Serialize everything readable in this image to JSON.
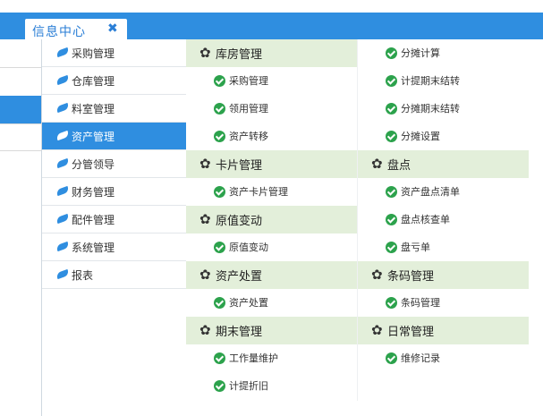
{
  "tab": {
    "title": "信息中心",
    "close": "✖"
  },
  "left_menu": [
    {
      "label": "采购管理"
    },
    {
      "label": "仓库管理"
    },
    {
      "label": "料室管理"
    },
    {
      "label": "资产管理",
      "active": true
    },
    {
      "label": "分管领导"
    },
    {
      "label": "财务管理"
    },
    {
      "label": "配件管理"
    },
    {
      "label": "系统管理"
    },
    {
      "label": "报表"
    }
  ],
  "submenu": {
    "col1": [
      {
        "type": "header",
        "label": "库房管理"
      },
      {
        "type": "item",
        "label": "采购管理"
      },
      {
        "type": "item",
        "label": "领用管理"
      },
      {
        "type": "item",
        "label": "资产转移"
      },
      {
        "type": "header",
        "label": "卡片管理"
      },
      {
        "type": "item",
        "label": "资产卡片管理"
      },
      {
        "type": "header",
        "label": "原值变动"
      },
      {
        "type": "item",
        "label": "原值变动"
      },
      {
        "type": "header",
        "label": "资产处置"
      },
      {
        "type": "item",
        "label": "资产处置"
      },
      {
        "type": "header",
        "label": "期末管理"
      },
      {
        "type": "item",
        "label": "工作量维护"
      },
      {
        "type": "item",
        "label": "计提折旧"
      }
    ],
    "col2": [
      {
        "type": "item",
        "label": "分摊计算"
      },
      {
        "type": "item",
        "label": "计提期末结转"
      },
      {
        "type": "item",
        "label": "分摊期末结转"
      },
      {
        "type": "item",
        "label": "分摊设置"
      },
      {
        "type": "header",
        "label": "盘点"
      },
      {
        "type": "item",
        "label": "资产盘点清单"
      },
      {
        "type": "item",
        "label": "盘点核查单"
      },
      {
        "type": "item",
        "label": "盘亏单"
      },
      {
        "type": "header",
        "label": "条码管理"
      },
      {
        "type": "item",
        "label": "条码管理"
      },
      {
        "type": "header",
        "label": "日常管理"
      },
      {
        "type": "item",
        "label": "维修记录"
      }
    ]
  },
  "icons": {
    "menu": "leaf-icon",
    "header": "gear-icon",
    "item": "check-circle-icon"
  },
  "colors": {
    "primary": "#2f8ee0",
    "header_bg": "#e3efda",
    "check": "#2ca24c"
  }
}
